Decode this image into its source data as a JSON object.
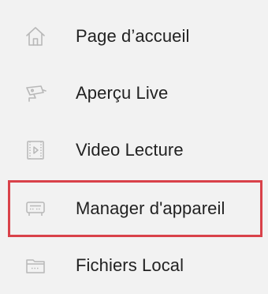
{
  "menu": {
    "items": [
      {
        "label": "Page d’accueil",
        "icon": "home-icon"
      },
      {
        "label": "Aperçu Live",
        "icon": "camera-icon"
      },
      {
        "label": "Video Lecture",
        "icon": "video-playback-icon"
      },
      {
        "label": "Manager d'appareil",
        "icon": "device-manager-icon",
        "highlighted": true
      },
      {
        "label": "Fichiers Local",
        "icon": "folder-icon"
      }
    ]
  },
  "colors": {
    "background": "#f2f2f2",
    "text": "#222222",
    "icon": "#b8b8b8",
    "highlight_border": "#d9424a"
  }
}
